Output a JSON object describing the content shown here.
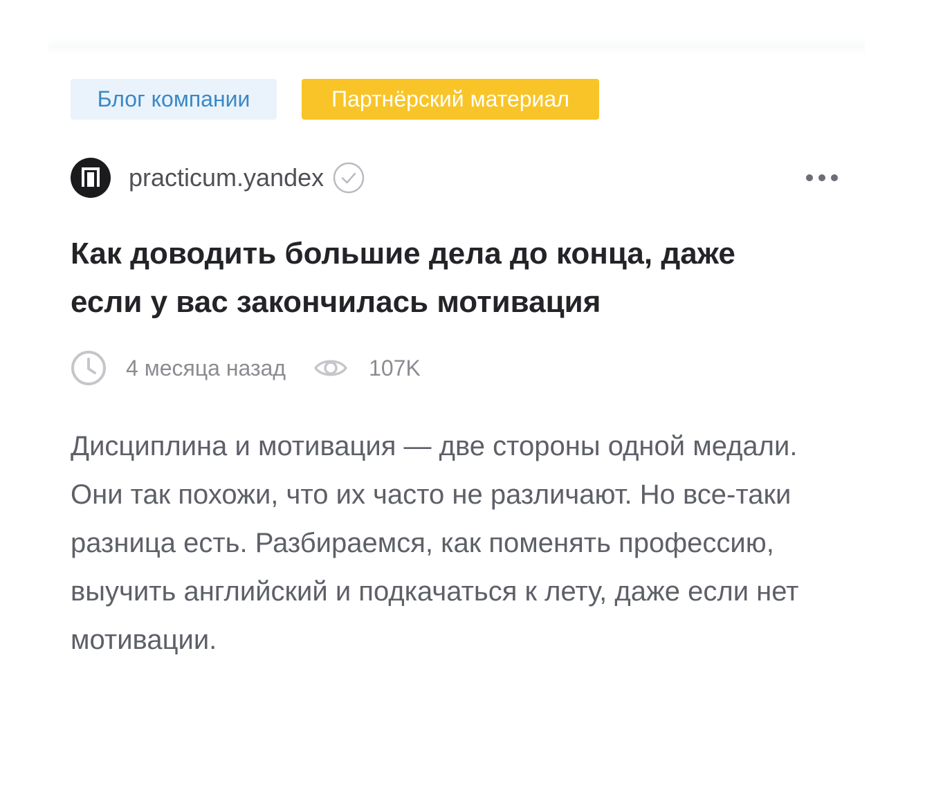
{
  "tags": {
    "blog_label": "Блог компании",
    "partner_label": "Партнёрский материал"
  },
  "author": {
    "name": "practicum.yandex",
    "avatar_icon": "practicum-logo-icon",
    "verified_icon": "verified-check-icon"
  },
  "menu": {
    "icon": "more-dots-icon"
  },
  "article": {
    "title": "Как доводить большие дела до конца, даже если у вас закончилась мотивация",
    "time_label": "4 месяца назад",
    "views_label": "107K",
    "lead": "Дисциплина и мотивация — две стороны одной медали. Они так похожи, что их часто не различают. Но все-таки разница есть. Разбираемся, как поменять профессию, выучить английский и подкачаться к лету, даже если нет мотивации."
  },
  "colors": {
    "tag_blog_bg": "#eaf3fb",
    "tag_blog_text": "#3a88c7",
    "tag_partner_bg": "#f8c428",
    "tag_partner_text": "#ffffff",
    "title": "#232428",
    "meta": "#8a8c91",
    "lead": "#5d6067"
  }
}
